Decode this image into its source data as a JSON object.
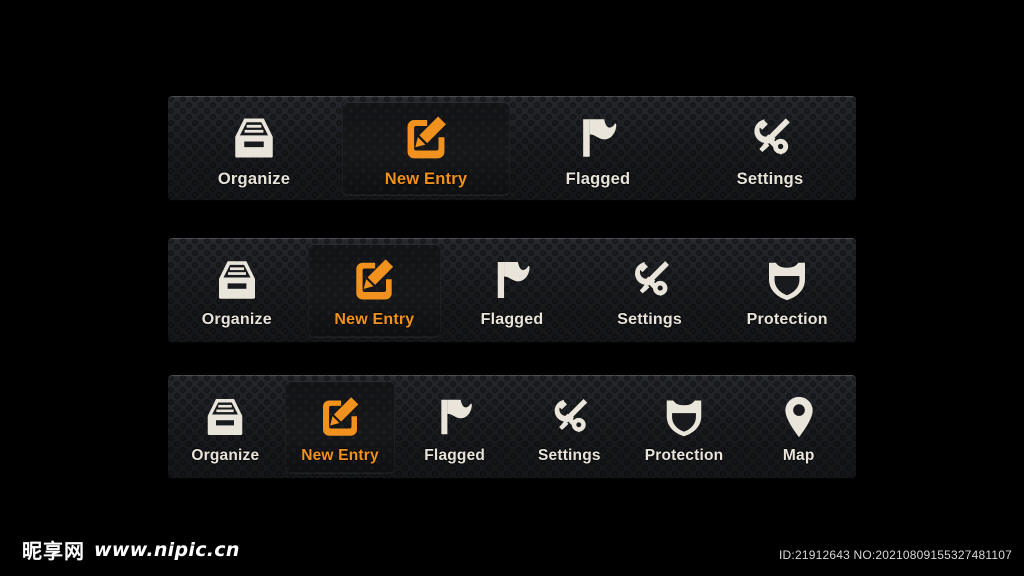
{
  "page": {
    "background_color": "#000000",
    "accent_color": "#f2921e",
    "icon_color": "#e9e5da",
    "bar_color": "#1c1e22"
  },
  "toolbars": [
    {
      "id": "toolbar-4-items",
      "items": [
        {
          "label": "Organize",
          "icon": "archive-tray-icon",
          "active": false
        },
        {
          "label": "New Entry",
          "icon": "compose-pencil-icon",
          "active": true
        },
        {
          "label": "Flagged",
          "icon": "flag-icon",
          "active": false
        },
        {
          "label": "Settings",
          "icon": "wrench-screwdriver-icon",
          "active": false
        }
      ]
    },
    {
      "id": "toolbar-5-items",
      "items": [
        {
          "label": "Organize",
          "icon": "archive-tray-icon",
          "active": false
        },
        {
          "label": "New Entry",
          "icon": "compose-pencil-icon",
          "active": true
        },
        {
          "label": "Flagged",
          "icon": "flag-icon",
          "active": false
        },
        {
          "label": "Settings",
          "icon": "wrench-screwdriver-icon",
          "active": false
        },
        {
          "label": "Protection",
          "icon": "shield-icon",
          "active": false
        }
      ]
    },
    {
      "id": "toolbar-6-items",
      "items": [
        {
          "label": "Organize",
          "icon": "archive-tray-icon",
          "active": false
        },
        {
          "label": "New Entry",
          "icon": "compose-pencil-icon",
          "active": true
        },
        {
          "label": "Flagged",
          "icon": "flag-icon",
          "active": false
        },
        {
          "label": "Settings",
          "icon": "wrench-screwdriver-icon",
          "active": false
        },
        {
          "label": "Protection",
          "icon": "shield-icon",
          "active": false
        },
        {
          "label": "Map",
          "icon": "map-pin-icon",
          "active": false
        }
      ]
    }
  ],
  "footer": {
    "watermark_cn": "昵享网",
    "watermark_url": "www.nipic.cn",
    "asset_id": "ID:21912643 NO:20210809155327481107"
  }
}
